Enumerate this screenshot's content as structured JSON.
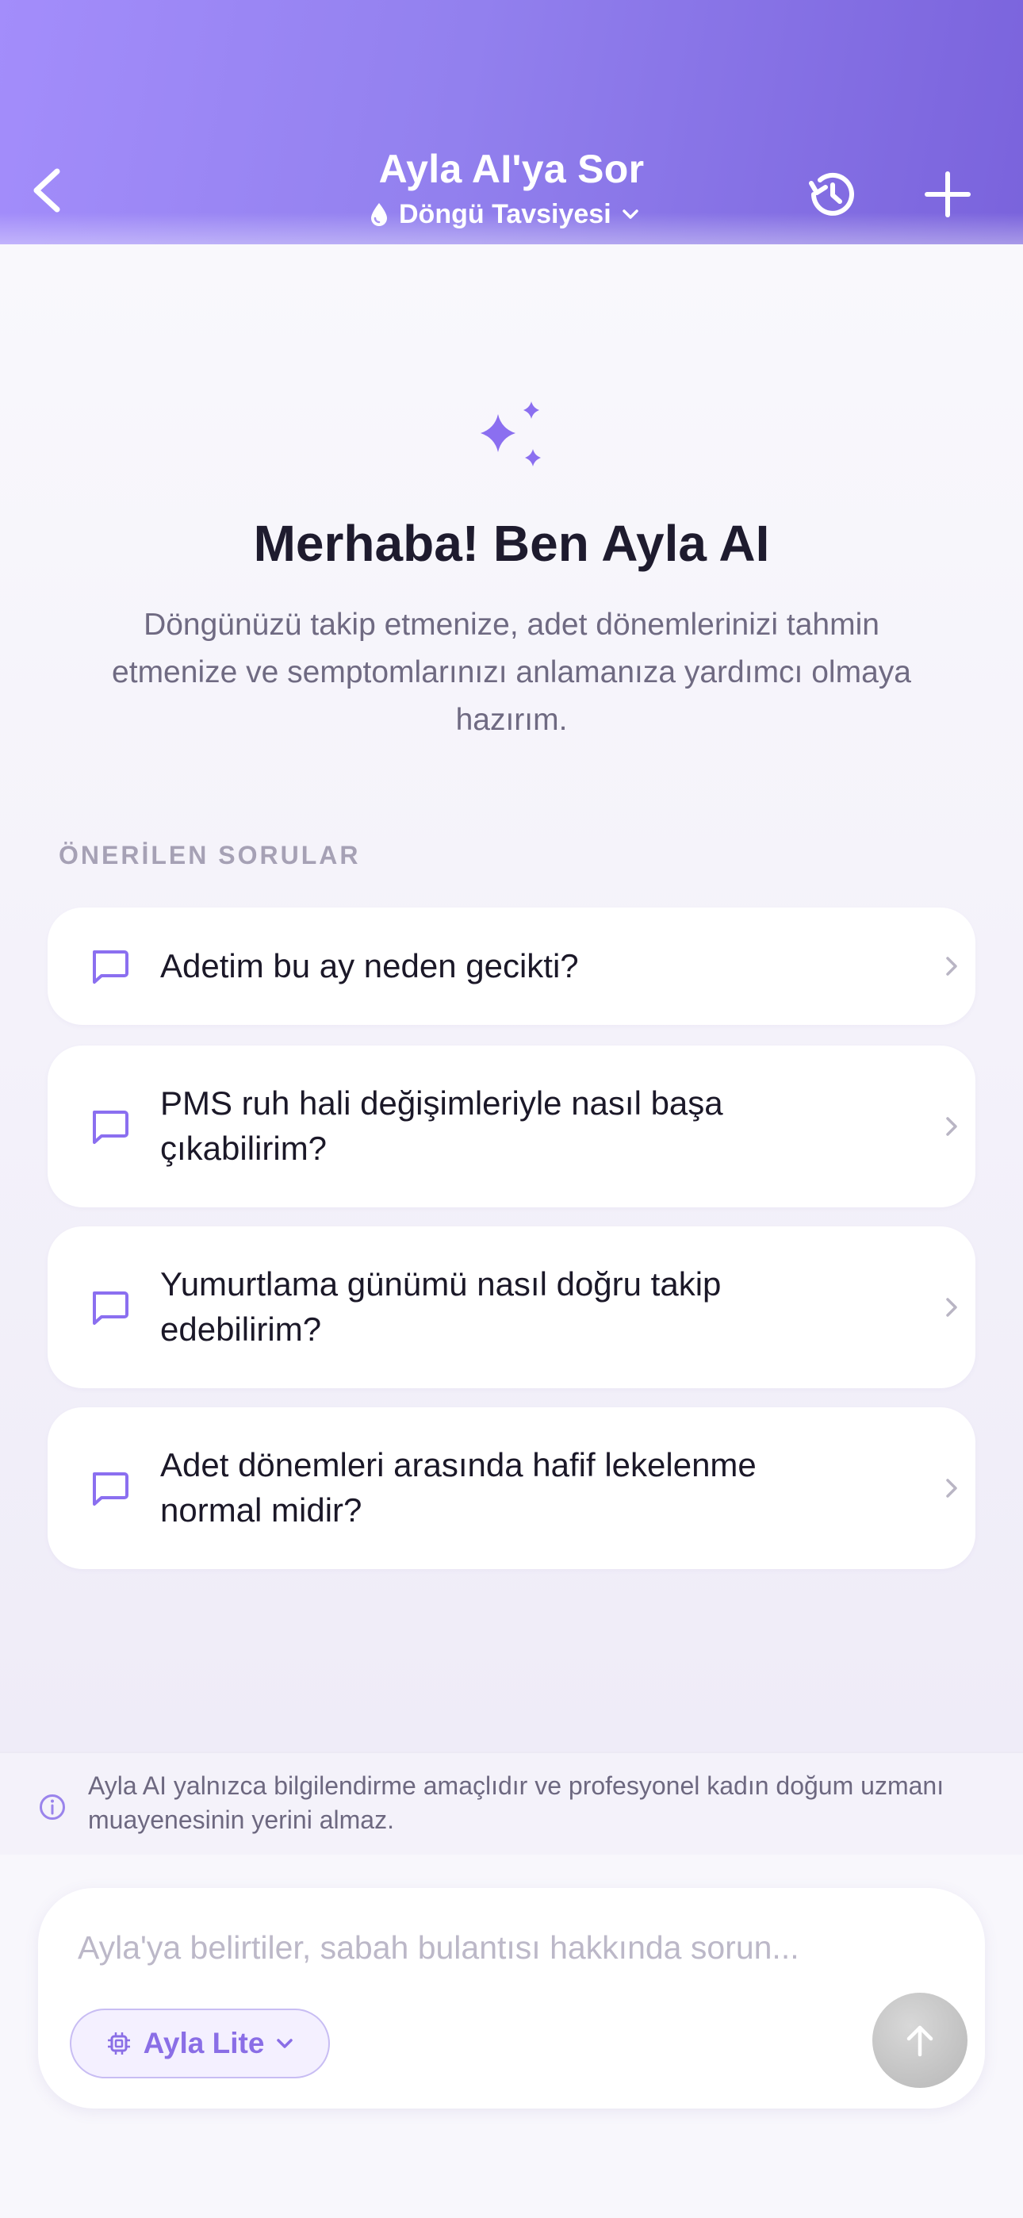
{
  "colors": {
    "header_gradient_start": "#a38dfb",
    "header_gradient_end": "#7a63dc",
    "accent": "#8a6ee6",
    "background": "#f6f4fb",
    "card": "#ffffff"
  },
  "header": {
    "title": "Ayla AI'ya Sor",
    "subtitle": "Döngü Tavsiyesi",
    "icons": {
      "back": "chevron-left-icon",
      "subtitle": "drop-icon",
      "subtitle_dropdown": "chevron-down-icon",
      "history": "history-icon",
      "add": "plus-icon"
    }
  },
  "welcome": {
    "icon": "sparkles-icon",
    "title": "Merhaba! Ben Ayla AI",
    "description": "Döngünüzü takip etmenize, adet dönemlerinizi tahmin etmenize ve semptomlarınızı anlamanıza yardımcı olmaya hazırım."
  },
  "suggestions": {
    "label": "ÖNERİLEN SORULAR",
    "items": [
      {
        "text": "Adetim bu ay neden gecikti?",
        "icon": "chat-bubble-icon"
      },
      {
        "text": "PMS ruh hali değişimleriyle nasıl başa çıkabilirim?",
        "icon": "chat-bubble-icon"
      },
      {
        "text": "Yumurtlama günümü nasıl doğru takip edebilirim?",
        "icon": "chat-bubble-icon"
      },
      {
        "text": "Adet dönemleri arasında hafif lekelenme normal midir?",
        "icon": "chat-bubble-icon"
      }
    ]
  },
  "disclaimer": {
    "icon": "info-icon",
    "text": "Ayla AI yalnızca bilgilendirme amaçlıdır ve profesyonel kadın doğum uzmanı muayenesinin yerini almaz."
  },
  "composer": {
    "placeholder": "Ayla'ya belirtiler, sabah bulantısı hakkında sorun...",
    "value": "",
    "model_label": "Ayla Lite",
    "model_icon": "chip-icon",
    "send_icon": "arrow-up-icon"
  }
}
